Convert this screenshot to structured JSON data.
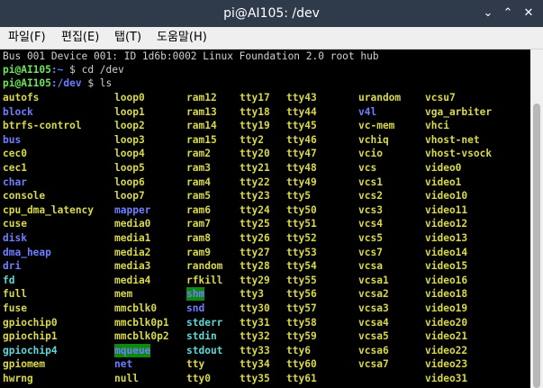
{
  "window": {
    "title": "pi@AI105: /dev",
    "min_icon": "chevron-down-icon",
    "restore_icon": "chevron-up-icon",
    "close_icon": "close-icon"
  },
  "menu": [
    "파일(F)",
    "편집(E)",
    "탭(T)",
    "도움말(H)"
  ],
  "terminal": {
    "lines": [
      {
        "text": "Bus 001 Device 001: ID 1d6b:0002 Linux Foundation 2.0 root hub"
      },
      {
        "user": "pi@AI105",
        "path": ":~ ",
        "cmd": "$ cd /dev"
      },
      {
        "user": "pi@AI105",
        "path": ":/dev ",
        "cmd": "$ ls"
      }
    ],
    "colors": {
      "y": "#d8d84a",
      "b": "#6f7dff",
      "c": "#5fd7d7",
      "w": "#ffffff",
      "shm_bg": "#0d8a0d"
    },
    "columns": [
      [
        [
          "autofs",
          "y"
        ],
        [
          "block",
          "b"
        ],
        [
          "btrfs-control",
          "y"
        ],
        [
          "bus",
          "b"
        ],
        [
          "cec0",
          "y"
        ],
        [
          "cec1",
          "y"
        ],
        [
          "char",
          "b"
        ],
        [
          "console",
          "y"
        ],
        [
          "cpu_dma_latency",
          "y"
        ],
        [
          "cuse",
          "y"
        ],
        [
          "disk",
          "b"
        ],
        [
          "dma_heap",
          "b"
        ],
        [
          "dri",
          "b"
        ],
        [
          "fd",
          "c"
        ],
        [
          "full",
          "y"
        ],
        [
          "fuse",
          "y"
        ],
        [
          "gpiochip0",
          "y"
        ],
        [
          "gpiochip1",
          "y"
        ],
        [
          "gpiochip4",
          "c"
        ],
        [
          "gpiomem",
          "y"
        ],
        [
          "hwrng",
          "y"
        ]
      ],
      [
        [
          "loop0",
          "y"
        ],
        [
          "loop1",
          "y"
        ],
        [
          "loop2",
          "y"
        ],
        [
          "loop3",
          "y"
        ],
        [
          "loop4",
          "y"
        ],
        [
          "loop5",
          "y"
        ],
        [
          "loop6",
          "y"
        ],
        [
          "loop7",
          "y"
        ],
        [
          "mapper",
          "b"
        ],
        [
          "media0",
          "y"
        ],
        [
          "media1",
          "y"
        ],
        [
          "media2",
          "y"
        ],
        [
          "media3",
          "y"
        ],
        [
          "media4",
          "y"
        ],
        [
          "mem",
          "y"
        ],
        [
          "mmcblk0",
          "y"
        ],
        [
          "mmcblk0p1",
          "y"
        ],
        [
          "mmcblk0p2",
          "y"
        ],
        [
          "mqueue",
          "hl"
        ],
        [
          "net",
          "b"
        ],
        [
          "null",
          "y"
        ]
      ],
      [
        [
          "ram12",
          "y"
        ],
        [
          "ram13",
          "y"
        ],
        [
          "ram14",
          "y"
        ],
        [
          "ram15",
          "y"
        ],
        [
          "ram2",
          "y"
        ],
        [
          "ram3",
          "y"
        ],
        [
          "ram4",
          "y"
        ],
        [
          "ram5",
          "y"
        ],
        [
          "ram6",
          "y"
        ],
        [
          "ram7",
          "y"
        ],
        [
          "ram8",
          "y"
        ],
        [
          "ram9",
          "y"
        ],
        [
          "random",
          "y"
        ],
        [
          "rfkill",
          "y"
        ],
        [
          "shm",
          "hl"
        ],
        [
          "snd",
          "b"
        ],
        [
          "stderr",
          "c"
        ],
        [
          "stdin",
          "c"
        ],
        [
          "stdout",
          "c"
        ],
        [
          "tty",
          "y"
        ],
        [
          "tty0",
          "y"
        ]
      ],
      [
        [
          "tty17",
          "y"
        ],
        [
          "tty18",
          "y"
        ],
        [
          "tty19",
          "y"
        ],
        [
          "tty2",
          "y"
        ],
        [
          "tty20",
          "y"
        ],
        [
          "tty21",
          "y"
        ],
        [
          "tty22",
          "y"
        ],
        [
          "tty23",
          "y"
        ],
        [
          "tty24",
          "y"
        ],
        [
          "tty25",
          "y"
        ],
        [
          "tty26",
          "y"
        ],
        [
          "tty27",
          "y"
        ],
        [
          "tty28",
          "y"
        ],
        [
          "tty29",
          "y"
        ],
        [
          "tty3",
          "y"
        ],
        [
          "tty30",
          "y"
        ],
        [
          "tty31",
          "y"
        ],
        [
          "tty32",
          "y"
        ],
        [
          "tty33",
          "y"
        ],
        [
          "tty34",
          "y"
        ],
        [
          "tty35",
          "y"
        ]
      ],
      [
        [
          "tty43",
          "y"
        ],
        [
          "tty44",
          "y"
        ],
        [
          "tty45",
          "y"
        ],
        [
          "tty46",
          "y"
        ],
        [
          "tty47",
          "y"
        ],
        [
          "tty48",
          "y"
        ],
        [
          "tty49",
          "y"
        ],
        [
          "tty5",
          "y"
        ],
        [
          "tty50",
          "y"
        ],
        [
          "tty51",
          "y"
        ],
        [
          "tty52",
          "y"
        ],
        [
          "tty53",
          "y"
        ],
        [
          "tty54",
          "y"
        ],
        [
          "tty55",
          "y"
        ],
        [
          "tty56",
          "y"
        ],
        [
          "tty57",
          "y"
        ],
        [
          "tty58",
          "y"
        ],
        [
          "tty59",
          "y"
        ],
        [
          "tty6",
          "y"
        ],
        [
          "tty60",
          "y"
        ],
        [
          "tty61",
          "y"
        ]
      ],
      [
        [
          "urandom",
          "y"
        ],
        [
          "v4l",
          "b"
        ],
        [
          "vc-mem",
          "y"
        ],
        [
          "vchiq",
          "y"
        ],
        [
          "vcio",
          "y"
        ],
        [
          "vcs",
          "y"
        ],
        [
          "vcs1",
          "y"
        ],
        [
          "vcs2",
          "y"
        ],
        [
          "vcs3",
          "y"
        ],
        [
          "vcs4",
          "y"
        ],
        [
          "vcs5",
          "y"
        ],
        [
          "vcs7",
          "y"
        ],
        [
          "vcsa",
          "y"
        ],
        [
          "vcsa1",
          "y"
        ],
        [
          "vcsa2",
          "y"
        ],
        [
          "vcsa3",
          "y"
        ],
        [
          "vcsa4",
          "y"
        ],
        [
          "vcsa5",
          "y"
        ],
        [
          "vcsa6",
          "y"
        ],
        [
          "vcsa7",
          "y"
        ]
      ],
      [
        [
          "vcsu7",
          "y"
        ],
        [
          "vga_arbiter",
          "y"
        ],
        [
          "vhci",
          "y"
        ],
        [
          "vhost-net",
          "y"
        ],
        [
          "vhost-vsock",
          "y"
        ],
        [
          "video0",
          "y"
        ],
        [
          "video1",
          "y"
        ],
        [
          "video10",
          "y"
        ],
        [
          "video11",
          "y"
        ],
        [
          "video12",
          "y"
        ],
        [
          "video13",
          "y"
        ],
        [
          "video14",
          "y"
        ],
        [
          "video15",
          "y"
        ],
        [
          "video16",
          "y"
        ],
        [
          "video18",
          "y"
        ],
        [
          "video19",
          "y"
        ],
        [
          "video20",
          "y"
        ],
        [
          "video21",
          "y"
        ],
        [
          "video22",
          "y"
        ],
        [
          "video23",
          "y"
        ],
        [
          "video31",
          "y"
        ]
      ]
    ]
  }
}
